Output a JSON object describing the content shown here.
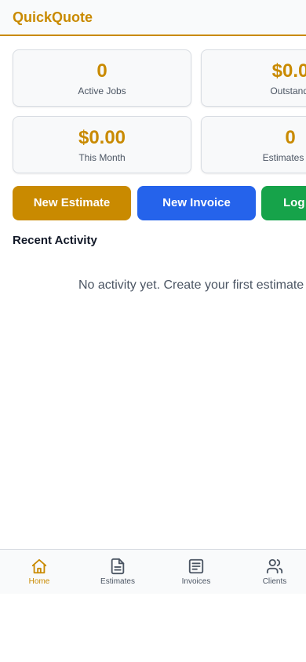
{
  "header": {
    "title": "QuickQuote"
  },
  "stats": {
    "active_jobs": {
      "value": "0",
      "label": "Active Jobs"
    },
    "outstanding": {
      "value": "$0.0",
      "label": "Outstandi"
    },
    "this_month": {
      "value": "$0.00",
      "label": "This Month"
    },
    "estimates_pending": {
      "value": "0",
      "label": "Estimates Pe"
    }
  },
  "actions": {
    "new_estimate": "New Estimate",
    "new_invoice": "New Invoice",
    "log": "Log"
  },
  "recent_activity": {
    "title": "Recent Activity",
    "empty_text": "No activity yet. Create your first estimate"
  },
  "nav": {
    "items": [
      {
        "label": "Home",
        "icon": "home-icon",
        "active": true
      },
      {
        "label": "Estimates",
        "icon": "file-icon",
        "active": false
      },
      {
        "label": "Invoices",
        "icon": "document-icon",
        "active": false
      },
      {
        "label": "Clients",
        "icon": "users-icon",
        "active": false
      }
    ]
  },
  "colors": {
    "brand": "#c98a00",
    "invoice_blue": "#2563eb",
    "log_green": "#16a34a"
  }
}
